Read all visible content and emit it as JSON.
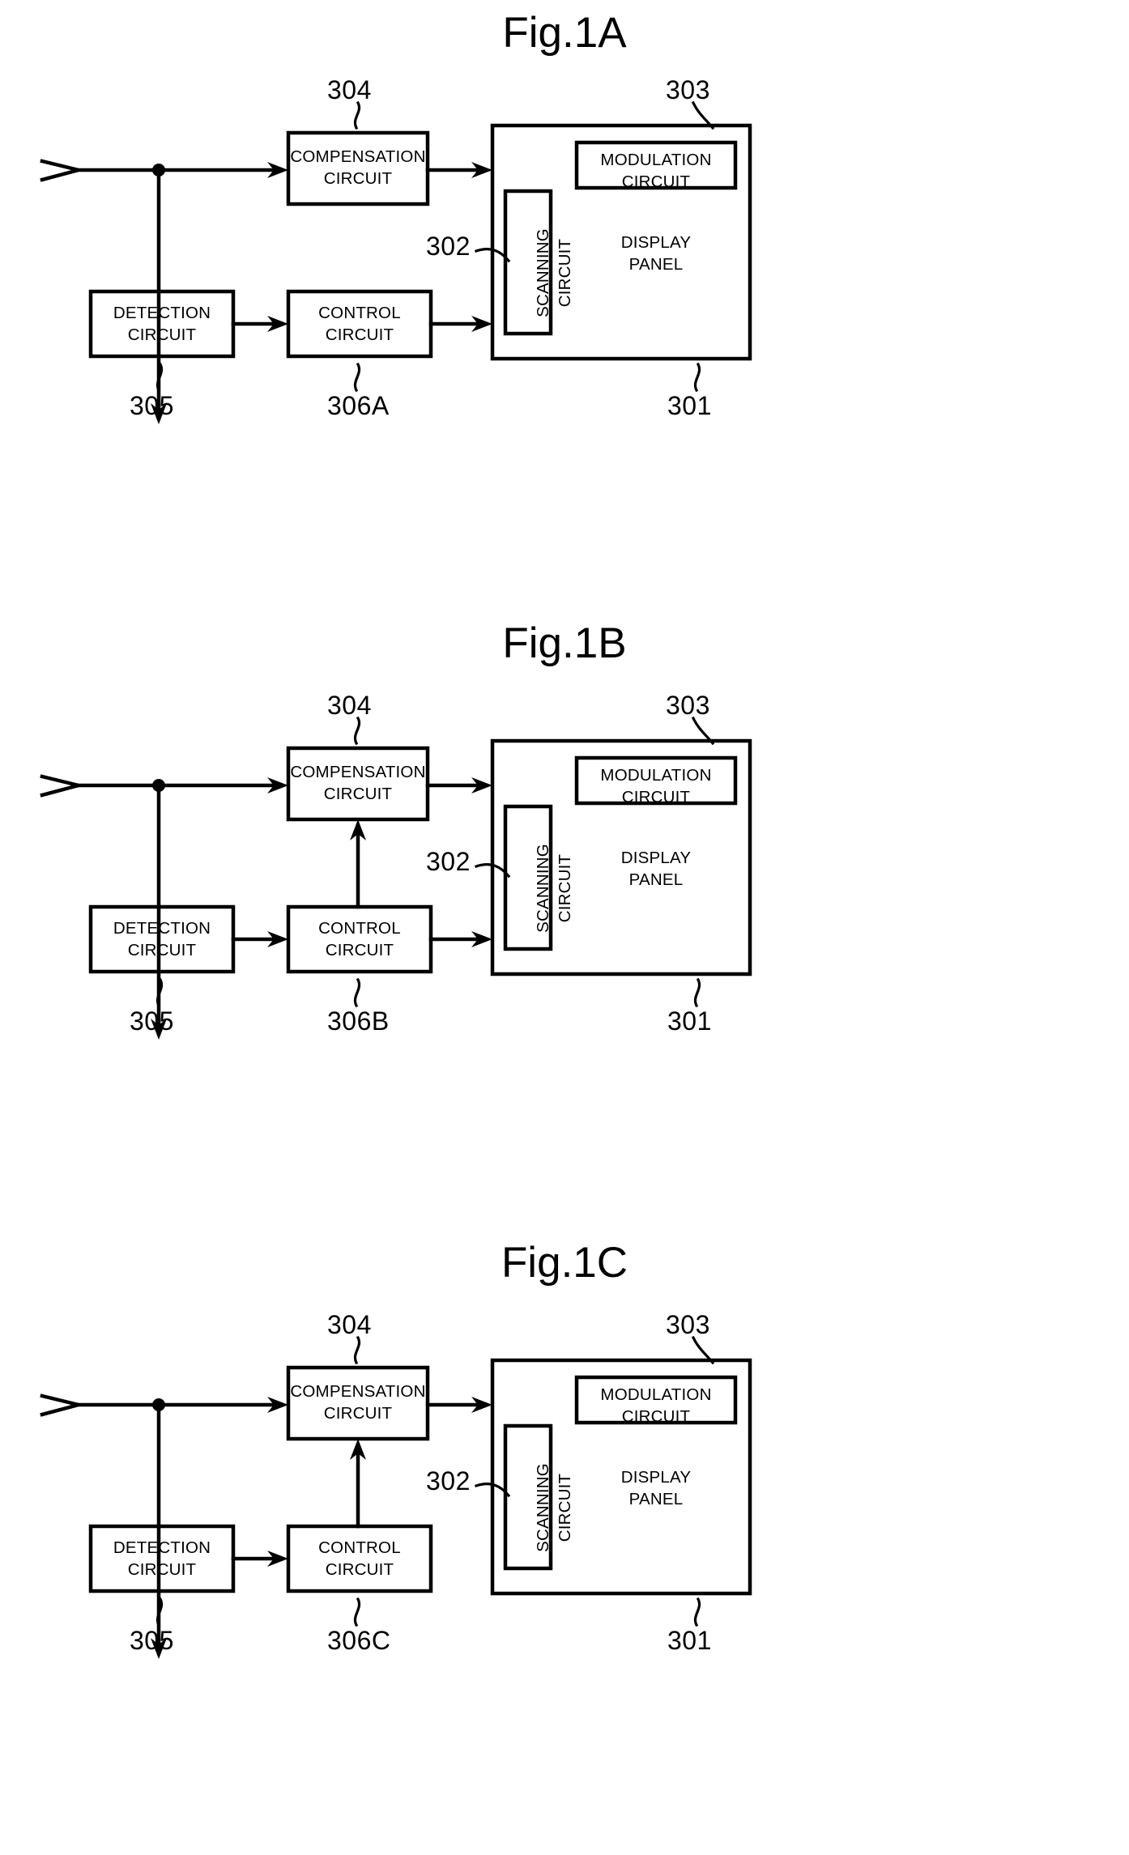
{
  "document": {
    "type": "patent-figure-sheet",
    "figure_count": 3
  },
  "figures": [
    {
      "id": "fig-a",
      "title": "Fig.1A",
      "boxes": {
        "compensation": "COMPENSATION\nCIRCUIT",
        "detection": "DETECTION\nCIRCUIT",
        "control": "CONTROL\nCIRCUIT",
        "modulation": "MODULATION\nCIRCUIT",
        "scanning": "SCANNING\nCIRCUIT",
        "display_panel": "DISPLAY\nPANEL"
      },
      "refs": {
        "compensation": "304",
        "modulation": "303",
        "scanning": "302",
        "detection": "305",
        "control": "306A",
        "panel": "301"
      },
      "feedback_arrow": false,
      "control_to_panel": true
    },
    {
      "id": "fig-b",
      "title": "Fig.1B",
      "boxes": {
        "compensation": "COMPENSATION\nCIRCUIT",
        "detection": "DETECTION\nCIRCUIT",
        "control": "CONTROL\nCIRCUIT",
        "modulation": "MODULATION\nCIRCUIT",
        "scanning": "SCANNING\nCIRCUIT",
        "display_panel": "DISPLAY\nPANEL"
      },
      "refs": {
        "compensation": "304",
        "modulation": "303",
        "scanning": "302",
        "detection": "305",
        "control": "306B",
        "panel": "301"
      },
      "feedback_arrow": true,
      "control_to_panel": true
    },
    {
      "id": "fig-c",
      "title": "Fig.1C",
      "boxes": {
        "compensation": "COMPENSATION\nCIRCUIT",
        "detection": "DETECTION\nCIRCUIT",
        "control": "CONTROL\nCIRCUIT",
        "modulation": "MODULATION\nCIRCUIT",
        "scanning": "SCANNING\nCIRCUIT",
        "display_panel": "DISPLAY\nPANEL"
      },
      "refs": {
        "compensation": "304",
        "modulation": "303",
        "scanning": "302",
        "detection": "305",
        "control": "306C",
        "panel": "301"
      },
      "feedback_arrow": true,
      "control_to_panel": false
    }
  ],
  "colors": {
    "ink": "#000000",
    "background": "#ffffff"
  }
}
